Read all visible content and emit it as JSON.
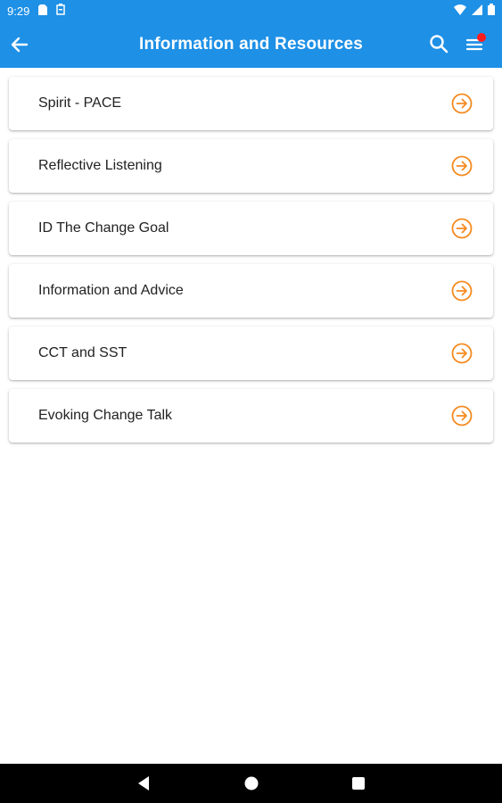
{
  "status": {
    "time": "9:29"
  },
  "app_bar": {
    "title": "Information and Resources"
  },
  "items": [
    {
      "label": "Spirit - PACE"
    },
    {
      "label": "Reflective Listening"
    },
    {
      "label": "ID The Change Goal"
    },
    {
      "label": "Information and Advice"
    },
    {
      "label": "CCT and SST"
    },
    {
      "label": "Evoking Change Talk"
    }
  ],
  "colors": {
    "primary": "#1e90e6",
    "accent": "#f58a1f",
    "badge": "#ff1c1c"
  },
  "icons": [
    "back-arrow-icon",
    "search-icon",
    "menu-icon",
    "arrow-right-circle-icon",
    "nav-back-icon",
    "nav-home-icon",
    "nav-recents-icon"
  ]
}
